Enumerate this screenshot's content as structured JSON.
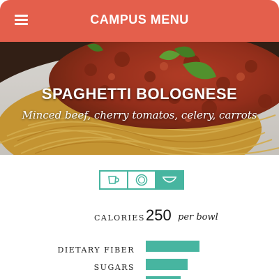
{
  "app_bar": {
    "title": "CAMPUS MENU",
    "menu_icon": "hamburger-menu-icon"
  },
  "hero": {
    "dish_name": "SPAGHETTI BOLOGNESE",
    "description": "Minced beef, cherry tomatos, celery, carrots"
  },
  "serving_toggle": {
    "options": [
      "cup-icon",
      "plate-icon",
      "bowl-icon"
    ],
    "selected": "bowl-icon"
  },
  "calories": {
    "label": "CALORIES",
    "value": "250",
    "unit": "per bowl"
  },
  "nutrients": [
    {
      "label": "DIETARY FIBER",
      "level": 0.77
    },
    {
      "label": "SUGARS",
      "level": 0.6
    },
    {
      "label": "",
      "level": 0.5
    }
  ],
  "colors": {
    "accent": "#e45f4c",
    "bar": "#47b5a0"
  }
}
